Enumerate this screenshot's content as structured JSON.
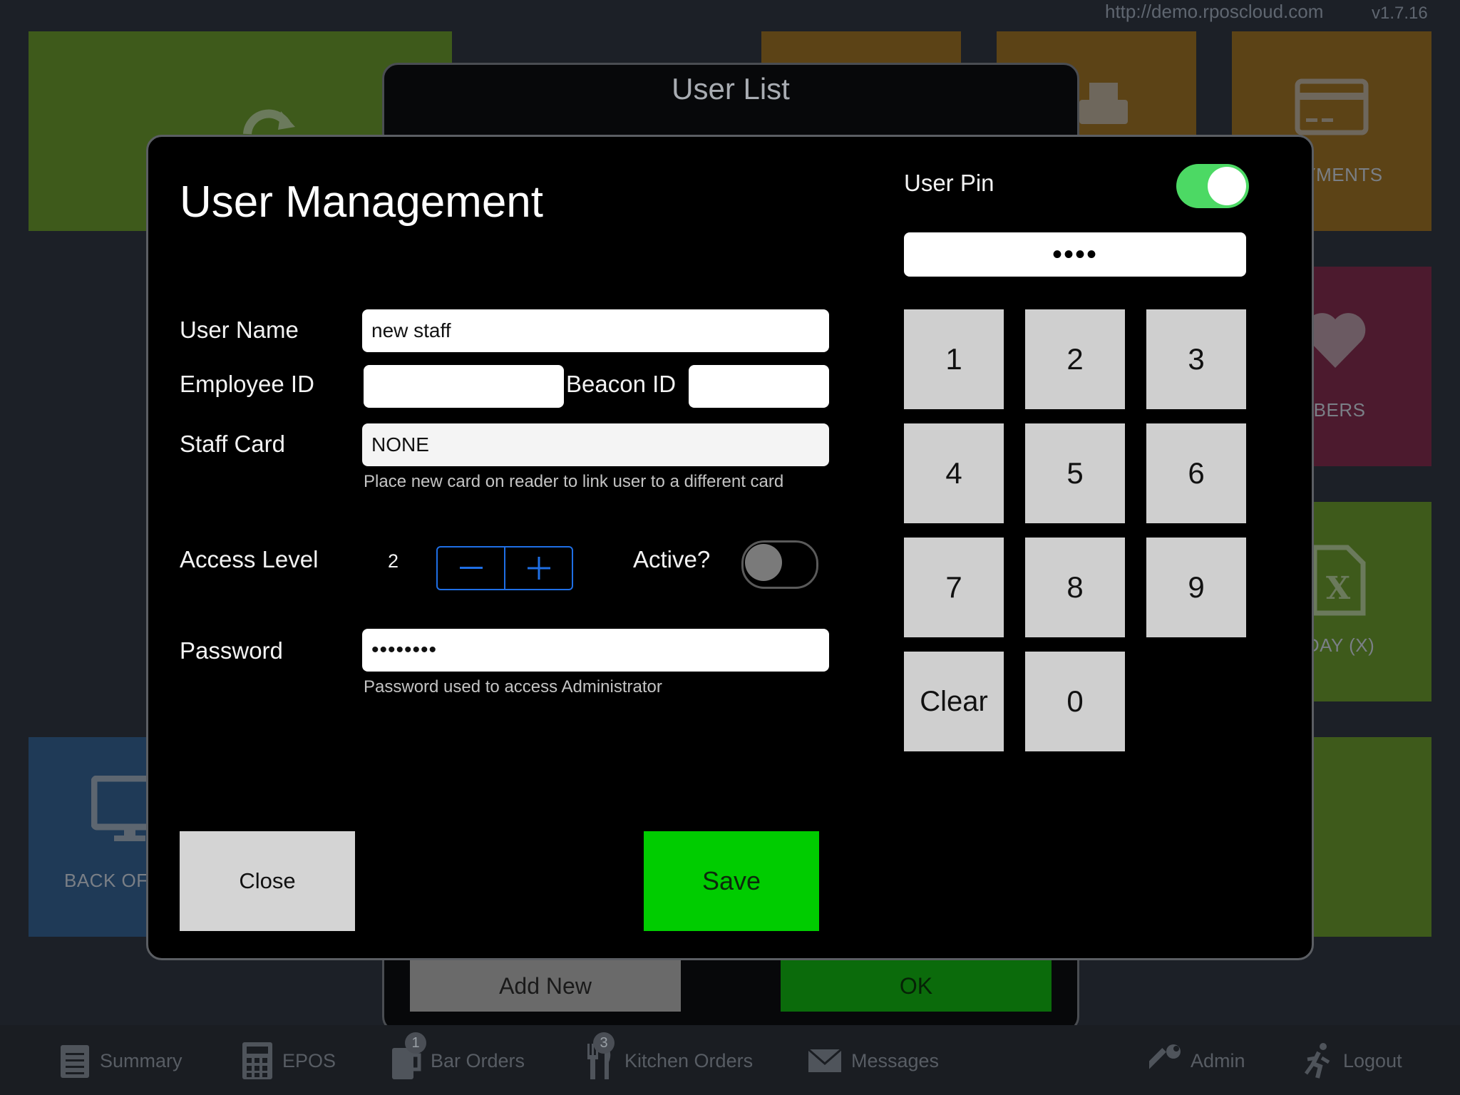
{
  "header": {
    "url": "http://demo.rposcloud.com",
    "version": "v1.7.16"
  },
  "tiles": {
    "payments": "PAYMENTS",
    "members": "MBERS",
    "x_day": "A DAY (X)",
    "back_office": "BACK OF"
  },
  "user_list": {
    "title": "User List",
    "add_new": "Add New",
    "ok": "OK"
  },
  "tab_bar": {
    "summary": "Summary",
    "epos": "EPOS",
    "bar_orders": "Bar Orders",
    "bar_orders_badge": "1",
    "kitchen_orders": "Kitchen Orders",
    "kitchen_orders_badge": "3",
    "messages": "Messages",
    "admin": "Admin",
    "logout": "Logout"
  },
  "modal": {
    "title": "User Management",
    "user_name_label": "User Name",
    "user_name_value": "new staff",
    "employee_id_label": "Employee ID",
    "employee_id_value": "",
    "beacon_id_label": "Beacon ID",
    "beacon_id_value": "",
    "staff_card_label": "Staff Card",
    "staff_card_value": "NONE",
    "staff_card_hint": "Place new card on reader to link user to a different card",
    "access_level_label": "Access Level",
    "access_level_value": "2",
    "active_label": "Active?",
    "active_on": false,
    "password_label": "Password",
    "password_value": "••••••••",
    "password_hint": "Password used to access Administrator",
    "user_pin_label": "User Pin",
    "user_pin_on": true,
    "pin_value": "••••",
    "keypad": [
      "1",
      "2",
      "3",
      "4",
      "5",
      "6",
      "7",
      "8",
      "9",
      "Clear",
      "0"
    ],
    "close_label": "Close",
    "save_label": "Save"
  },
  "colors": {
    "accent_blue": "#1f6fe5",
    "toggle_green": "#4cd964",
    "save_green": "#00cc00"
  }
}
